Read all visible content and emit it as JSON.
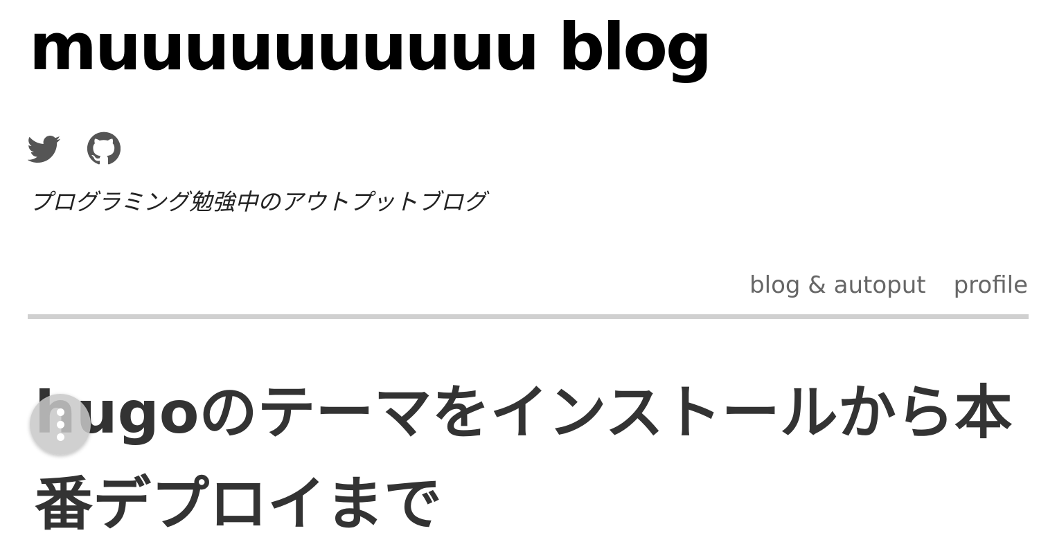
{
  "site": {
    "title": "muuuuuuuuuu blog",
    "tagline": "プログラミング勉強中のアウトプットブログ"
  },
  "social": {
    "icons": [
      "twitter-icon",
      "github-icon"
    ],
    "icon_color": "#555555"
  },
  "nav": {
    "items": [
      {
        "label": "blog & autoput"
      },
      {
        "label": "profile"
      }
    ]
  },
  "post": {
    "title": "hugoのテーマをインストールから本番デプロイまで"
  },
  "fab": {
    "icon": "more-vertical-icon"
  },
  "colors": {
    "title": "#000000",
    "text": "#333333",
    "nav": "#666666",
    "divider": "#d0d0d0"
  }
}
